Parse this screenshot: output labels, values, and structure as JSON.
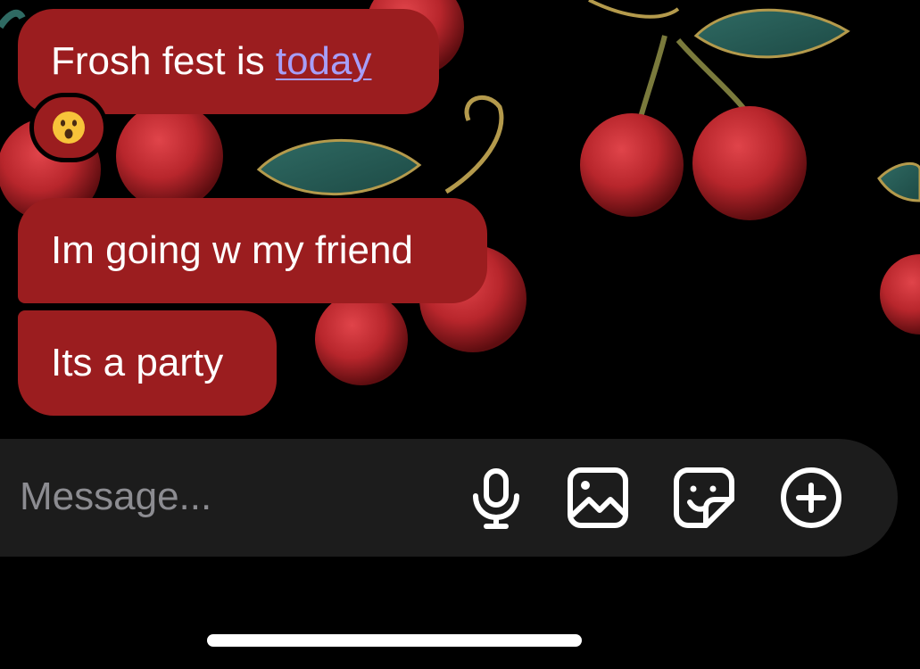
{
  "messages": [
    {
      "prefix": "Frosh fest is ",
      "link": "today"
    },
    {
      "text": "Im going w my friend"
    },
    {
      "text": "Its a party"
    }
  ],
  "reaction": {
    "emoji": "😮",
    "icon": "hushed-face-emoji"
  },
  "composer": {
    "placeholder": "Message...",
    "value": "",
    "icons": [
      "microphone-icon",
      "image-icon",
      "sticker-icon",
      "plus-circle-icon"
    ]
  },
  "colors": {
    "bubble": "#9b1d1f",
    "link": "#a79ef8",
    "composer_bg": "#1c1c1c",
    "placeholder": "#8c8c91",
    "background": "#000000"
  }
}
